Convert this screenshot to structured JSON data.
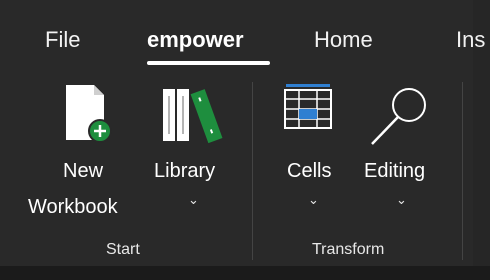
{
  "tabs": [
    {
      "label": "File"
    },
    {
      "label": "empower"
    },
    {
      "label": "Home"
    },
    {
      "label": "Ins"
    }
  ],
  "active_tab": "empower",
  "groups": {
    "start": {
      "label": "Start",
      "commands": {
        "new_workbook": {
          "label_line1": "New",
          "label_line2": "Workbook",
          "icon": "new-workbook-icon"
        },
        "library": {
          "label": "Library",
          "icon": "library-books-icon",
          "has_dropdown": true
        }
      }
    },
    "transform": {
      "label": "Transform",
      "commands": {
        "cells": {
          "label": "Cells",
          "icon": "table-cells-icon",
          "has_dropdown": true
        },
        "editing": {
          "label": "Editing",
          "icon": "magnifier-icon",
          "has_dropdown": true
        }
      }
    }
  },
  "chevron_glyph": "⌄",
  "colors": {
    "ribbon_bg": "#292929",
    "accent_green": "#1e8e3e",
    "accent_blue": "#2f7fd1"
  }
}
